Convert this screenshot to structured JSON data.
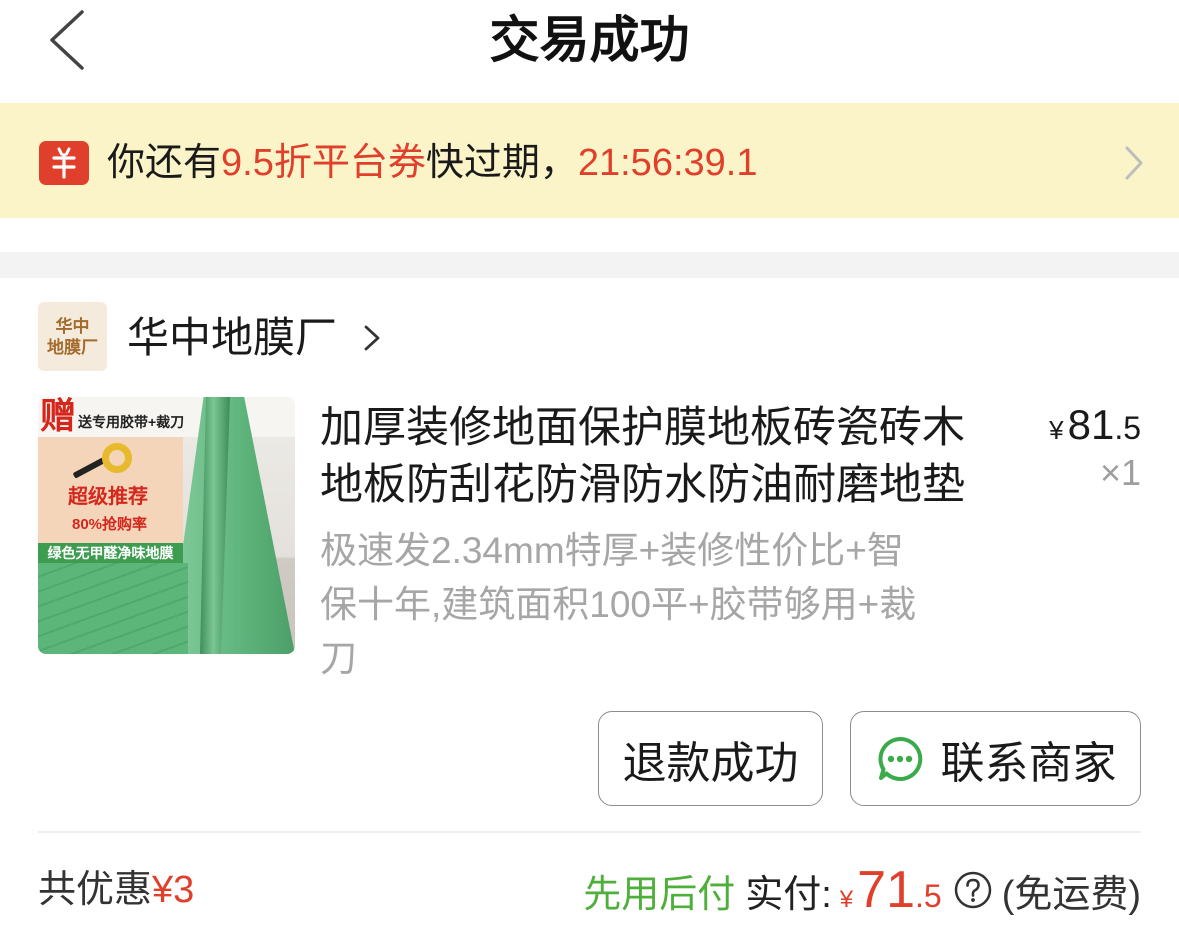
{
  "theme": {
    "accent_red": "#E0402B",
    "pay_later_green": "#4FAF3B",
    "banner_bg": "#FBF4C8",
    "muted_gray": "#A6A6A6"
  },
  "header": {
    "back_icon": "chevron-left-icon",
    "title": "交易成功"
  },
  "banner": {
    "icon": "coupon-icon",
    "text_prefix": "你还有",
    "highlight": "9.5折平台券",
    "text_suffix": "快过期，",
    "countdown": "21:56:39.1",
    "chevron_icon": "chevron-right-icon"
  },
  "store": {
    "logo_line1": "华中",
    "logo_line2": "地膜厂",
    "name": "华中地膜厂",
    "chevron_icon": "chevron-right-icon"
  },
  "product": {
    "image": {
      "gift_char": "赠",
      "gift_text": "送专用胶带+裁刀",
      "promo_title": "超级推荐",
      "promo_rate": "80%抢购率",
      "band_text": "绿色无甲醛净味地膜"
    },
    "title_lines": [
      "加厚装修地面保护膜地板砖瓷砖木",
      "地板防刮花防滑防水防油耐磨地垫"
    ],
    "sku_lines": [
      "极速发2.34mm特厚+装修性价比+智",
      "保十年,建筑面积100平+胶带够用+裁",
      "刀"
    ],
    "price": {
      "currency": "¥",
      "integer": "81",
      "decimal": ".5"
    },
    "quantity": "×1"
  },
  "actions": {
    "refund_label": "退款成功",
    "contact_icon": "chat-bubble-icon",
    "contact_label": "联系商家"
  },
  "summary": {
    "discount_label": "共优惠",
    "discount_amount": "¥3",
    "pay_later": "先用后付",
    "paid_label": "实付:",
    "paid_currency": "¥",
    "paid_integer": "71",
    "paid_decimal": ".5",
    "help_icon": "question-circle-icon",
    "shipping_note": "(免运费)"
  }
}
